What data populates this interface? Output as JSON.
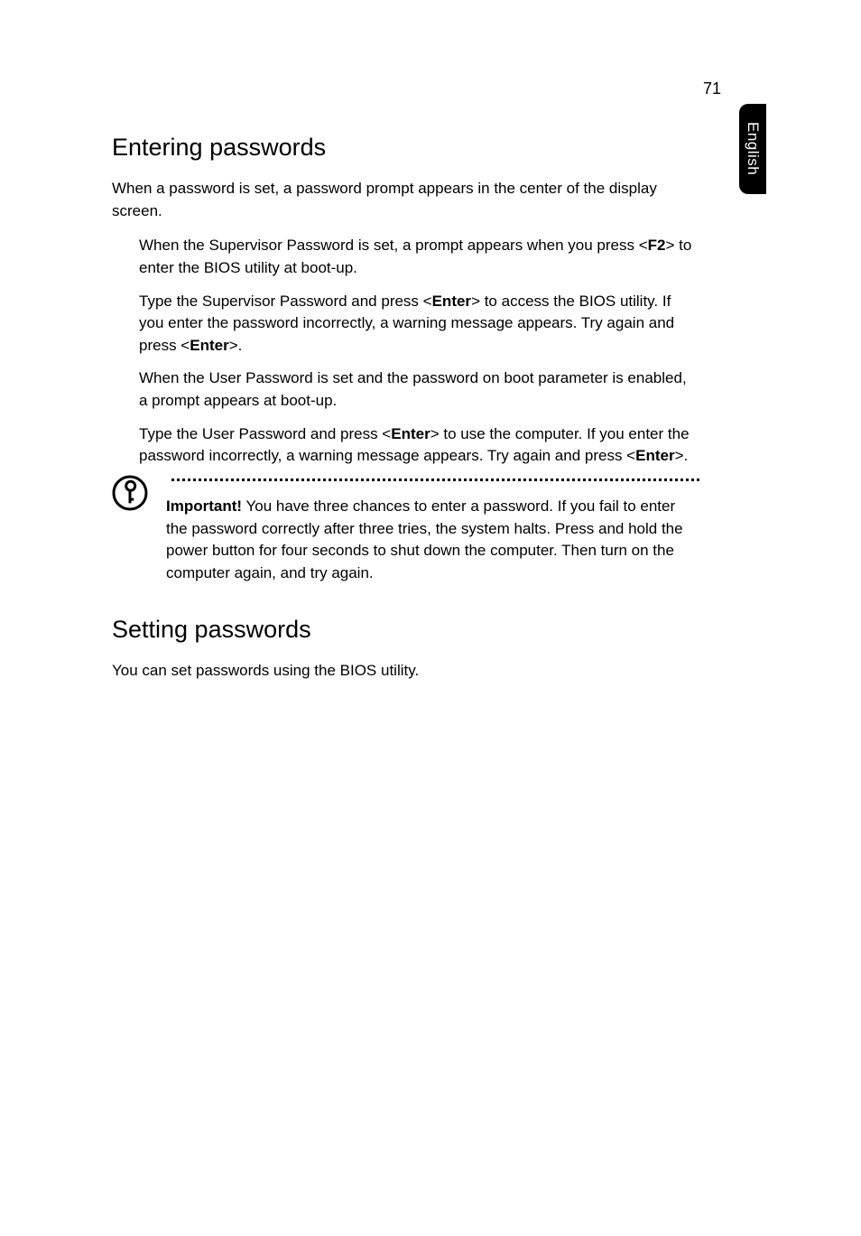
{
  "page_number": "71",
  "side_tab": "English",
  "section1": {
    "heading": "Entering passwords",
    "intro": "When a password is set, a password prompt appears in the center of the display screen.",
    "bullets": {
      "b0_pre": "When the Supervisor Password is set, a prompt appears when you press <",
      "b0_key": "F2",
      "b0_post": "> to enter the BIOS utility at boot-up.",
      "b1_pre": "Type the Supervisor Password and press <",
      "b1_key1": "Enter",
      "b1_mid": "> to access the BIOS utility. If you enter the password incorrectly, a warning message appears. Try again and press <",
      "b1_key2": "Enter",
      "b1_post": ">.",
      "b2": "When the User Password is set and the password on boot parameter is enabled, a prompt appears at boot-up.",
      "b3_pre": "Type the User Password and press <",
      "b3_key1": "Enter",
      "b3_mid": "> to use the computer. If you enter the password incorrectly, a warning message appears. Try again and press <",
      "b3_key2": "Enter",
      "b3_post": ">."
    },
    "note": {
      "label": "Important!",
      "text": " You have three chances to enter a password. If you fail to enter the password correctly after three tries, the system halts. Press and hold the power button for four seconds to shut down the computer. Then turn on the computer again, and try again."
    }
  },
  "section2": {
    "heading": "Setting passwords",
    "intro": "You can set passwords using the BIOS utility."
  }
}
